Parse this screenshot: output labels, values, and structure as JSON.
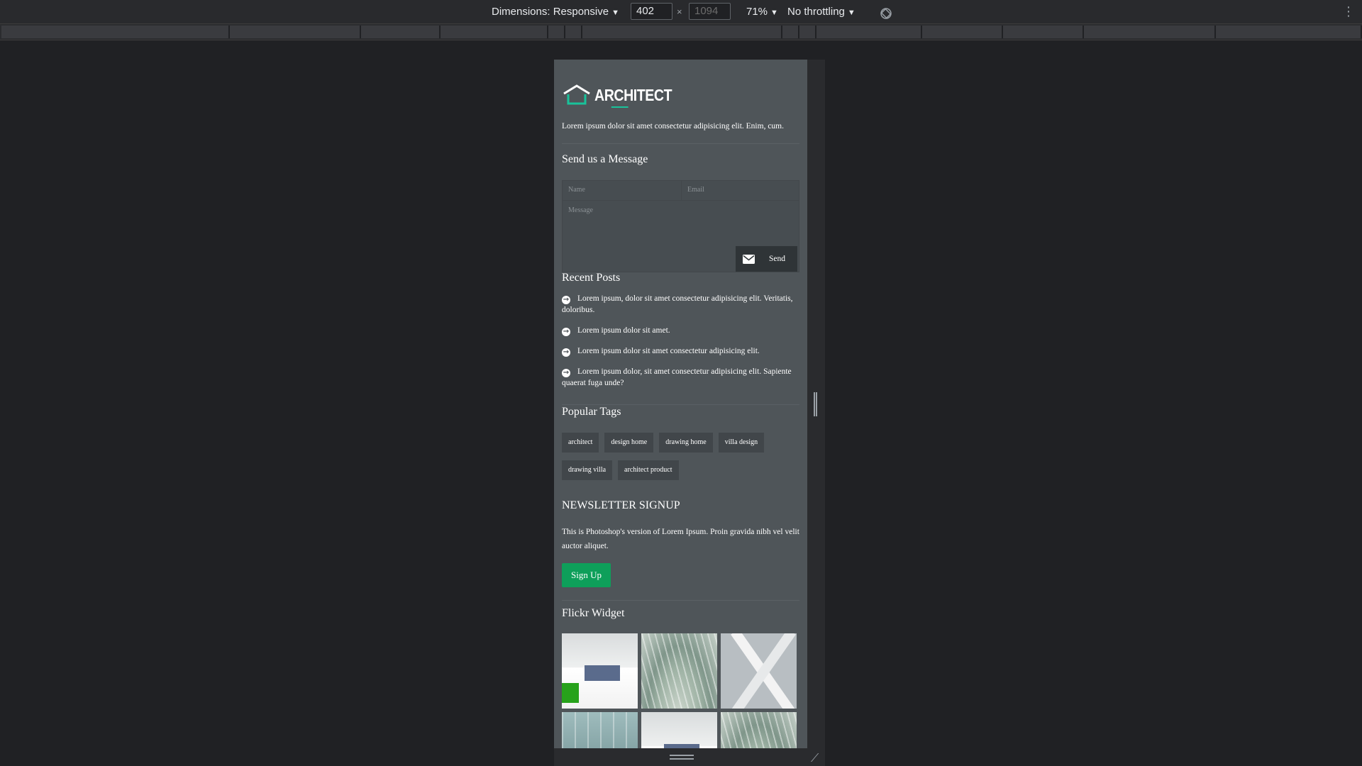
{
  "devtools": {
    "dimensions_label": "Dimensions: Responsive",
    "width_value": "402",
    "height_value": "1094",
    "times_sign": "×",
    "zoom_label": "71%",
    "throttling_label": "No throttling"
  },
  "site": {
    "logo_text": "ARCHITECT",
    "intro": "Lorem ipsum dolor sit amet consectetur adipisicing elit. Enim, cum.",
    "contact": {
      "title": "Send us a Message",
      "name_placeholder": "Name",
      "email_placeholder": "Email",
      "message_placeholder": "Message",
      "send_label": "Send"
    },
    "recent_posts": {
      "title": "Recent Posts",
      "items": [
        "Lorem ipsum, dolor sit amet consectetur adipisicing elit. Veritatis, doloribus.",
        "Lorem ipsum dolor sit amet.",
        "Lorem ipsum dolor sit amet consectetur adipisicing elit.",
        "Lorem ipsum dolor, sit amet consectetur adipisicing elit. Sapiente quaerat fuga unde?"
      ]
    },
    "popular_tags": {
      "title": "Popular Tags",
      "tags": [
        "architect",
        "design home",
        "drawing home",
        "villa design",
        "drawing villa",
        "architect product"
      ]
    },
    "newsletter": {
      "title": "NEWSLETTER SIGNUP",
      "text": "This is Photoshop's version of Lorem Ipsum. Proin gravida nibh vel velit auctor aliquet.",
      "button": "Sign Up"
    },
    "flickr": {
      "title": "Flickr Widget"
    }
  }
}
